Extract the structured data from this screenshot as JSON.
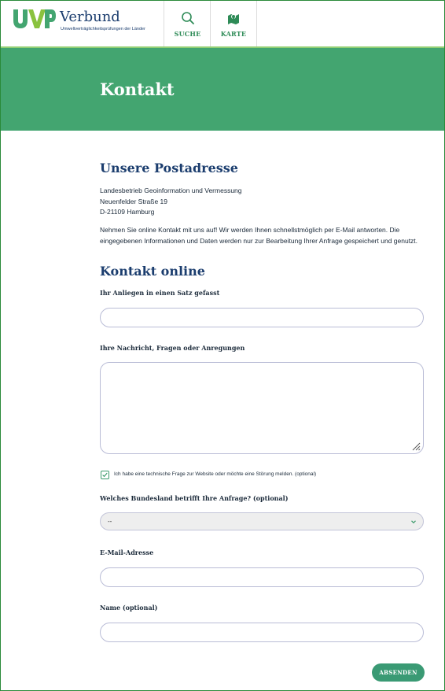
{
  "header": {
    "logo_mark": "UVP",
    "logo_title": "Verbund",
    "logo_subtitle": "Umweltverträglichkeitsprüfungen der Länder",
    "nav": [
      {
        "label": "SUCHE",
        "icon": "search-icon"
      },
      {
        "label": "KARTE",
        "icon": "map-icon"
      }
    ],
    "colors": {
      "brand_green": "#43a570",
      "brand_navy": "#1b3d6e",
      "logo_green": "#8ac23e"
    }
  },
  "banner": {
    "title": "Kontakt"
  },
  "address": {
    "heading": "Unsere Postadresse",
    "lines": [
      "Landesbetrieb Geoinformation und Vermessung",
      "Neuenfelder Straße 19",
      "D-21109 Hamburg"
    ],
    "intro": "Nehmen Sie online Kontakt mit uns auf! Wir werden Ihnen schnellstmöglich per E-Mail antworten. Die eingegebenen Informationen und Daten werden nur zur Bearbeitung Ihrer Anfrage gespeichert und genutzt."
  },
  "form": {
    "heading": "Kontakt online",
    "subject_label": "Ihr Anliegen in einen Satz gefasst",
    "subject_value": "",
    "message_label": "Ihre Nachricht, Fragen oder Anregungen",
    "message_value": "",
    "technical_checkbox_label": "Ich habe eine technische Frage zur Website oder möchte eine Störung melden. (optional)",
    "technical_checked": true,
    "state_label": "Welches Bundesland betrifft Ihre Anfrage? (optional)",
    "state_value": "--",
    "email_label": "E-Mail-Adresse",
    "email_value": "",
    "name_label": "Name (optional)",
    "name_value": "",
    "submit_label": "ABSENDEN"
  }
}
